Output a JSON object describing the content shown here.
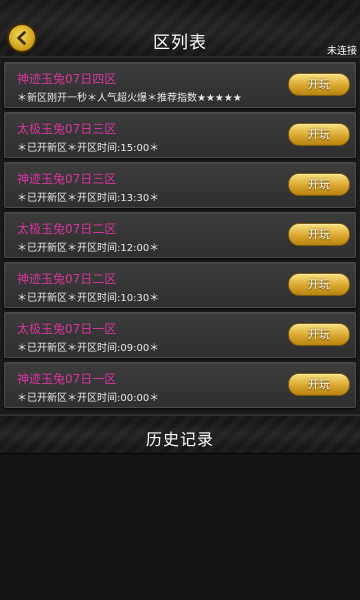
{
  "header": {
    "title": "区列表",
    "status": "未连接",
    "back_icon": "back-arrow-icon"
  },
  "servers": [
    {
      "name": "神迹玉兔07日四区",
      "desc": "＊新区刚开一秒＊人气超火爆＊推荐指数★★★★★",
      "button": "开玩",
      "color": "#d9359f"
    },
    {
      "name": "太极玉兔07日三区",
      "desc": "＊已开新区＊开区时间:15:00＊",
      "button": "开玩",
      "color": "#d9359f"
    },
    {
      "name": "神迹玉兔07日三区",
      "desc": "＊已开新区＊开区时间:13:30＊",
      "button": "开玩",
      "color": "#d9359f"
    },
    {
      "name": "太极玉兔07日二区",
      "desc": "＊已开新区＊开区时间:12:00＊",
      "button": "开玩",
      "color": "#d9359f"
    },
    {
      "name": "神迹玉兔07日二区",
      "desc": "＊已开新区＊开区时间:10:30＊",
      "button": "开玩",
      "color": "#d9359f"
    },
    {
      "name": "太极玉兔07日一区",
      "desc": "＊已开新区＊开区时间:09:00＊",
      "button": "开玩",
      "color": "#d9359f"
    },
    {
      "name": "神迹玉兔07日一区",
      "desc": "＊已开新区＊开区时间:00:00＊",
      "button": "开玩",
      "color": "#d9359f"
    }
  ],
  "history": {
    "title": "历史记录"
  }
}
